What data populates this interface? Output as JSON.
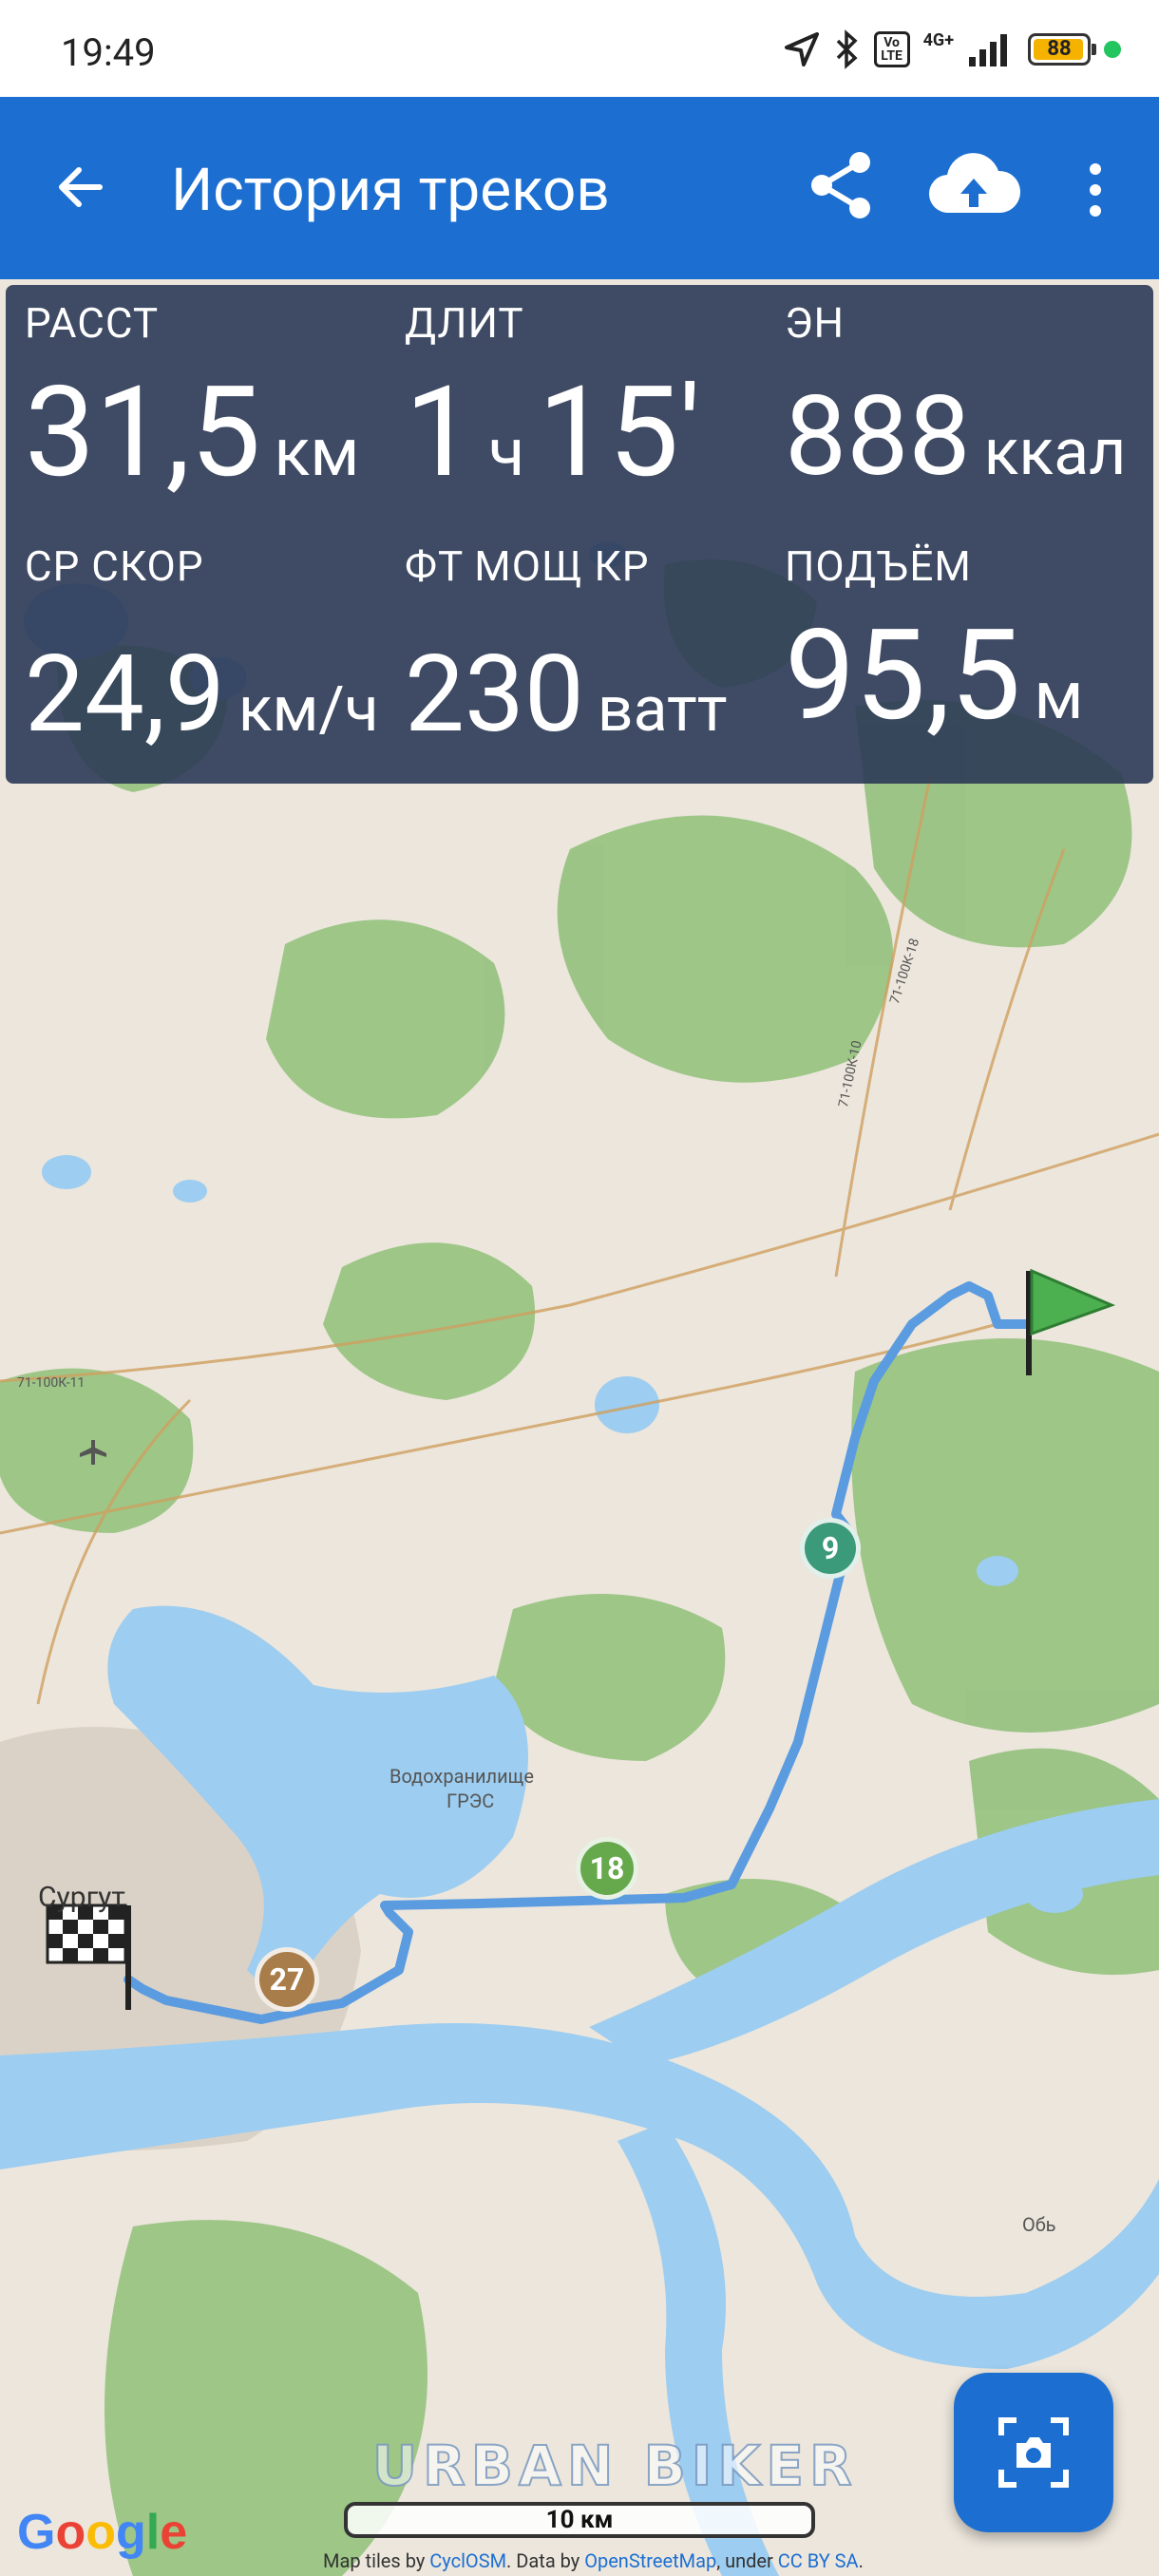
{
  "status_bar": {
    "time": "19:49",
    "network": "4G+",
    "volte": "Vo LTE",
    "battery": "88"
  },
  "app_bar": {
    "title": "История треков",
    "icons": [
      "back-arrow-icon",
      "share-icon",
      "cloud-upload-icon",
      "more-vert-icon"
    ]
  },
  "stats": [
    {
      "label": "РАССТ",
      "value": "31,5",
      "unit": "км"
    },
    {
      "label": "ДЛИТ",
      "value": "1",
      "unit": "ч",
      "value2": "15'"
    },
    {
      "label": "ЭН",
      "value": "888",
      "unit": "ккал"
    },
    {
      "label": "СР СКОР",
      "value": "24,9",
      "unit": "км/ч"
    },
    {
      "label": "ФТ МОЩ КР",
      "value": "230",
      "unit": "ватт"
    },
    {
      "label": "ПОДЪЁМ",
      "value": "95,5",
      "unit": "м"
    }
  ],
  "map": {
    "city_label": "Сургут",
    "reservoir_label_1": "Водохранилище",
    "reservoir_label_2": "ГРЭС",
    "river_label": "Обь",
    "road_label_1": "71-100К-11",
    "road_label_2": "71-100К-10",
    "road_label_3": "71-100К-18",
    "markers": [
      "9",
      "18",
      "27"
    ],
    "scale": "10 км",
    "watermark": "URBAN BIKER",
    "google_logo": "Google",
    "attribution": {
      "prefix": "Map tiles by ",
      "tiles": "CyclOSM",
      "mid": ". Data by ",
      "data": "OpenStreetMap",
      "under": ", under ",
      "license": "CC BY SA",
      "end": "."
    }
  },
  "colors": {
    "app_bar": "#1c6fd1",
    "track": "#5b9be0",
    "water": "#9dcdf0",
    "forest": "#7fb56a"
  },
  "fab_icon": "screenshot-camera-icon"
}
